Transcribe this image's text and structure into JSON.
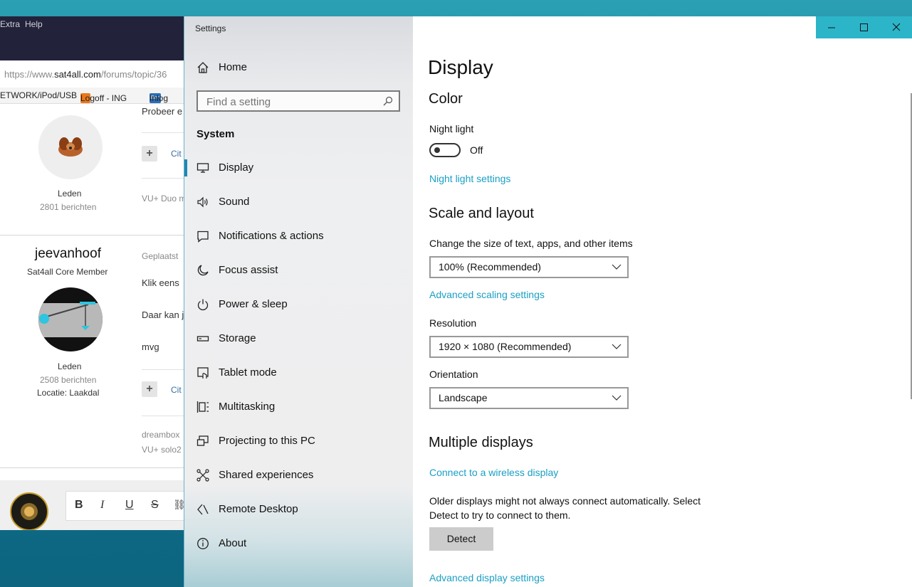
{
  "browser": {
    "menu": [
      "Extra",
      "Help"
    ],
    "url_prefix": "https://www.",
    "url_domain": "sat4all.com",
    "url_path": "/forums/topic/36",
    "bookmarks": [
      "ETWORK/iPod/USB",
      "Logoff - ING",
      "Inlog"
    ],
    "bookmark_badge": "Ben",
    "post1": {
      "role": "Leden",
      "count": "2801 berichten",
      "text": "Probeer e",
      "quote": "Cit",
      "signature": "VU+ Duo m"
    },
    "post2": {
      "username": "jeevanhoof",
      "rank": "Sat4all Core Member",
      "posted": "Geplaatst",
      "line1": "Klik eens",
      "line2": "Daar kan j",
      "line3": "mvg",
      "role": "Leden",
      "count": "2508 berichten",
      "location": "Locatie: Laakdal",
      "quote": "Cit",
      "sig1": "dreambox",
      "sig2": "VU+ solo2"
    },
    "editor": {
      "bold": "B",
      "italic": "I",
      "underline": "U",
      "strike": "S"
    }
  },
  "settings": {
    "window_title": "Settings",
    "home_label": "Home",
    "search_placeholder": "Find a setting",
    "section": "System",
    "nav": [
      {
        "label": "Display",
        "icon": "monitor-icon"
      },
      {
        "label": "Sound",
        "icon": "speaker-icon"
      },
      {
        "label": "Notifications & actions",
        "icon": "notification-icon"
      },
      {
        "label": "Focus assist",
        "icon": "moon-icon"
      },
      {
        "label": "Power & sleep",
        "icon": "power-icon"
      },
      {
        "label": "Storage",
        "icon": "storage-icon"
      },
      {
        "label": "Tablet mode",
        "icon": "tablet-icon"
      },
      {
        "label": "Multitasking",
        "icon": "multitasking-icon"
      },
      {
        "label": "Projecting to this PC",
        "icon": "projector-icon"
      },
      {
        "label": "Shared experiences",
        "icon": "share-icon"
      },
      {
        "label": "Remote Desktop",
        "icon": "remote-desktop-icon"
      },
      {
        "label": "About",
        "icon": "info-icon"
      }
    ],
    "page_title": "Display",
    "color": {
      "heading": "Color",
      "night_light_label": "Night light",
      "night_light_state": "Off",
      "night_light_link": "Night light settings"
    },
    "scale": {
      "heading": "Scale and layout",
      "size_label": "Change the size of text, apps, and other items",
      "size_value": "100% (Recommended)",
      "advanced_scaling_link": "Advanced scaling settings",
      "resolution_label": "Resolution",
      "resolution_value": "1920 × 1080 (Recommended)",
      "orientation_label": "Orientation",
      "orientation_value": "Landscape"
    },
    "multi": {
      "heading": "Multiple displays",
      "wireless_link": "Connect to a wireless display",
      "desc_line1": "Older displays might not always connect automatically. Select",
      "desc_line2": "Detect to try to connect to them.",
      "detect_button": "Detect",
      "advanced_display_link": "Advanced display settings"
    },
    "colors": {
      "accent": "#1a9fc4",
      "titlebar": "#2cb5c9"
    }
  }
}
